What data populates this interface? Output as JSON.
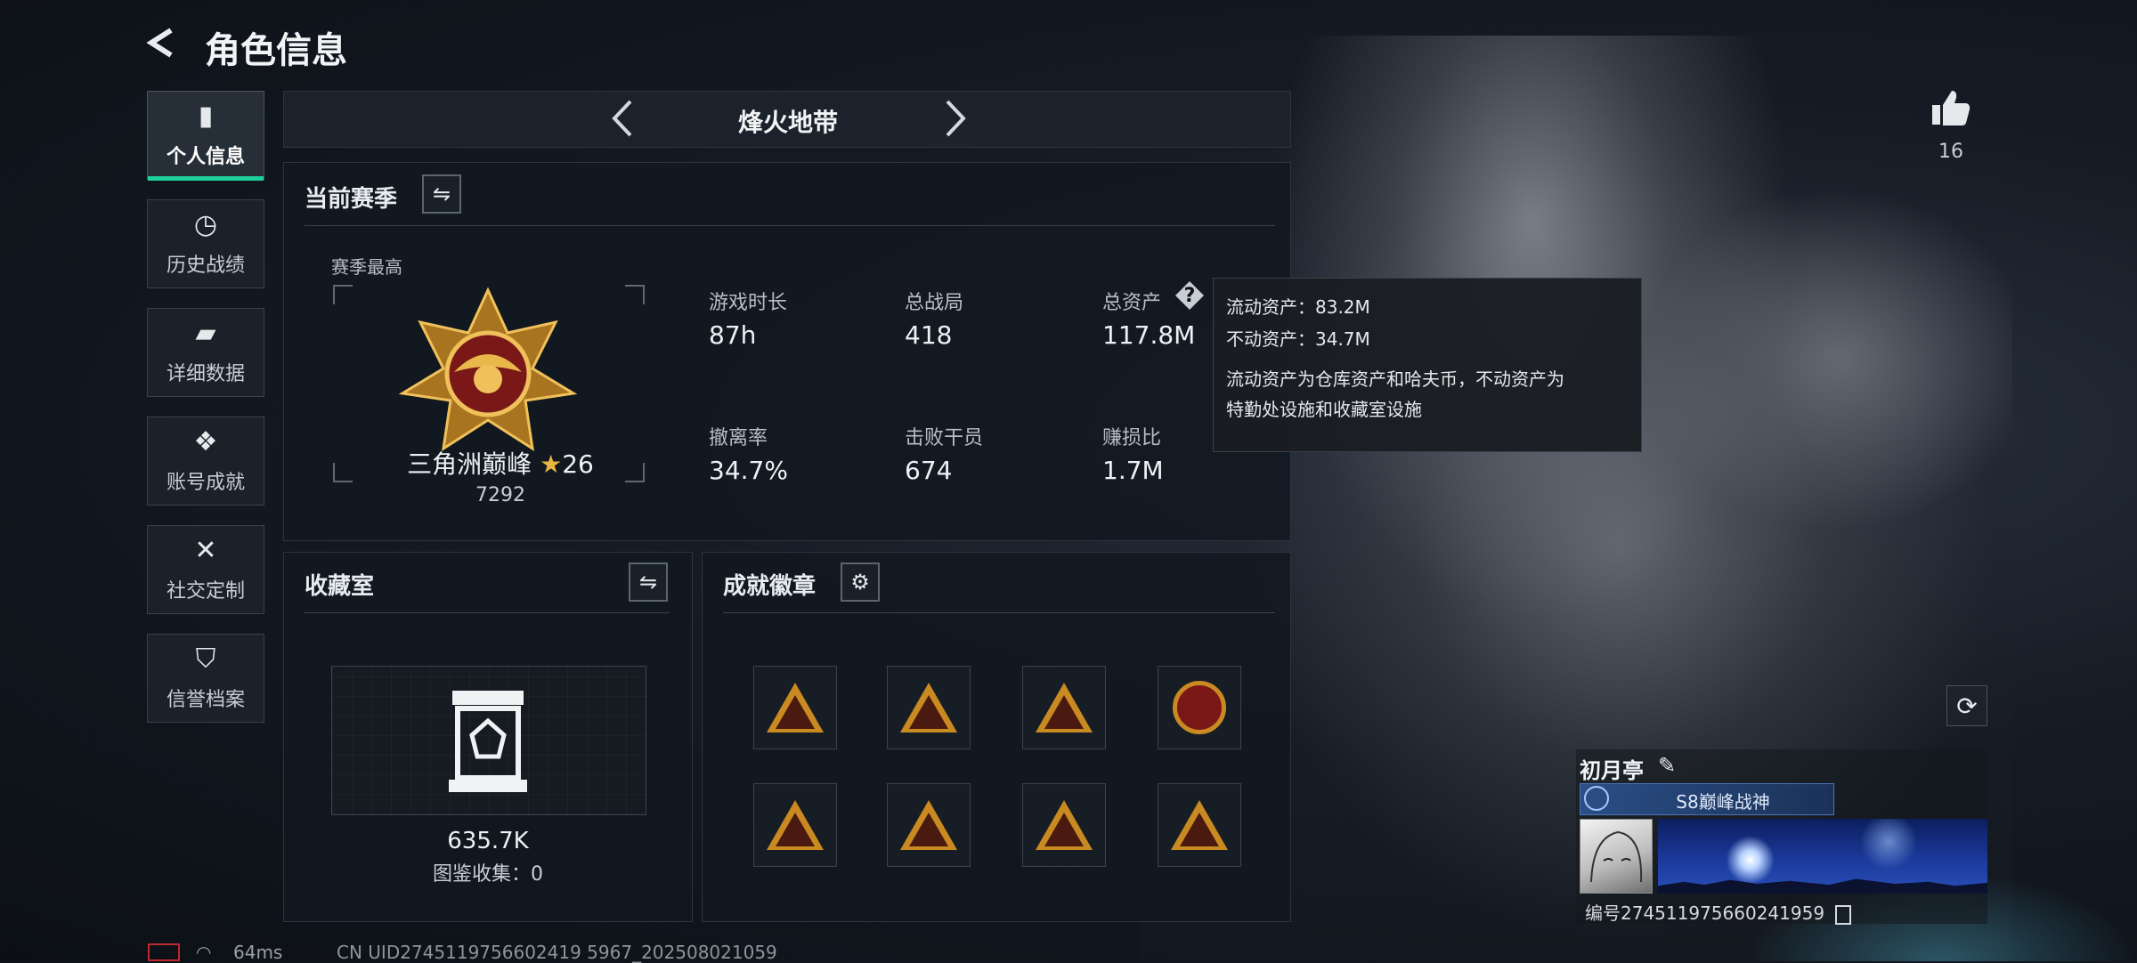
{
  "header": {
    "title": "角色信息"
  },
  "nav": {
    "items": [
      {
        "label": "个人信息",
        "icon": "bar-chart-icon",
        "glyph": "▮",
        "active": true
      },
      {
        "label": "历史战绩",
        "icon": "clock-icon",
        "glyph": "◷",
        "active": false
      },
      {
        "label": "详细数据",
        "icon": "folder-icon",
        "glyph": "▰",
        "active": false
      },
      {
        "label": "账号成就",
        "icon": "achievement-icon",
        "glyph": "❖",
        "active": false
      },
      {
        "label": "社交定制",
        "icon": "tools-icon",
        "glyph": "✕",
        "active": false
      },
      {
        "label": "信誉档案",
        "icon": "shield-icon",
        "glyph": "⛉",
        "active": false
      }
    ]
  },
  "mode_selector": {
    "label": "烽火地带",
    "prev_icon": "chevron-left-icon",
    "next_icon": "chevron-right-icon"
  },
  "season": {
    "title": "当前赛季",
    "swap_icon": "swap-icon",
    "best_label": "赛季最高",
    "rank_name": "三角洲巅峰",
    "rank_stars": "26",
    "rank_score": "7292",
    "stats": [
      {
        "label": "游戏时长",
        "value": "87h"
      },
      {
        "label": "总战局",
        "value": "418"
      },
      {
        "label": "总资产",
        "value": "117.8M",
        "help": true
      },
      {
        "label": "撤离率",
        "value": "34.7%"
      },
      {
        "label": "击败干员",
        "value": "674"
      },
      {
        "label": "赚损比",
        "value": "1.7M"
      }
    ]
  },
  "tooltip": {
    "liquid": "流动资产：83.2M",
    "fixed": "不动资产：34.7M",
    "desc_line1": "流动资产为仓库资产和哈夫币，不动资产为",
    "desc_line2": "特勤处设施和收藏室设施"
  },
  "collection": {
    "title": "收藏室",
    "value": "635.7K",
    "catalog": "图鉴收集：0"
  },
  "achievements": {
    "title": "成就徽章",
    "settings_icon": "gear-icon",
    "badge_count": 8
  },
  "likes": {
    "icon": "thumbs-up-icon",
    "count": "16"
  },
  "player": {
    "name": "初月亭",
    "edit_icon": "edit-icon",
    "title_badge": "S8巅峰战神",
    "id_text": "编号274511975660241959",
    "copy_icon": "copy-icon"
  },
  "refresh_icon": "refresh-icon",
  "footer": {
    "ping": "64ms",
    "uid": "CN UID2745119756602419 5967_202508021059"
  },
  "colors": {
    "accent": "#1ed09a",
    "gold": "#c98a22",
    "tooltip_bg": "#1a1d22"
  }
}
